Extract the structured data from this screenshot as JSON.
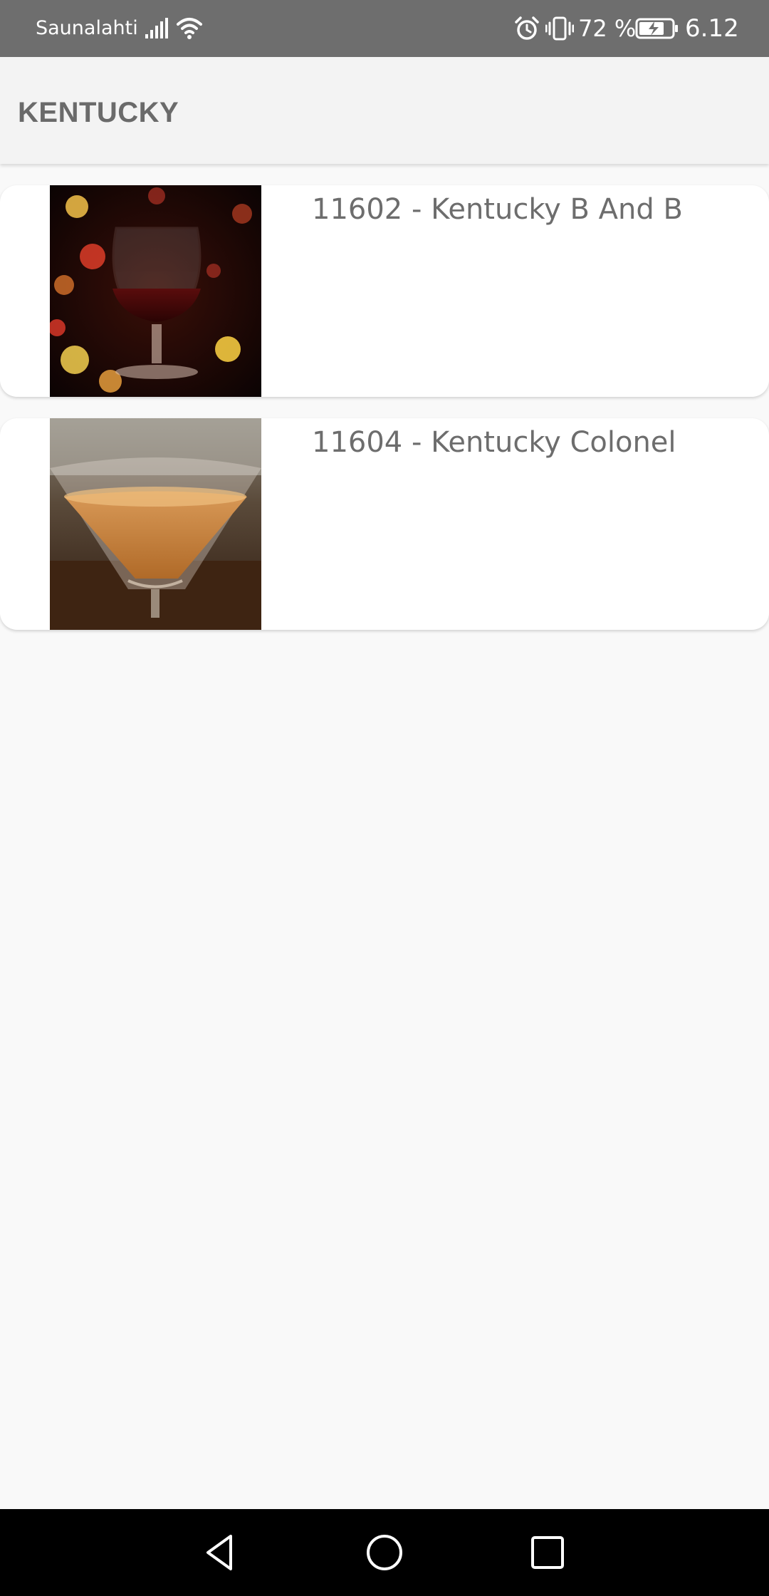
{
  "status_bar": {
    "carrier": "Saunalahti",
    "battery_percent": "72 %",
    "time": "6.12",
    "icons": [
      "signal-icon",
      "wifi-icon",
      "alarm-icon",
      "vibrate-icon",
      "battery-charging-icon"
    ]
  },
  "app_bar": {
    "title": "KENTUCKY"
  },
  "drinks": [
    {
      "label": "11602 - Kentucky B And B",
      "image": "brandy-snifter-image"
    },
    {
      "label": "11604 - Kentucky Colonel",
      "image": "martini-glass-image"
    }
  ],
  "nav_bar": {
    "icons": [
      "back-icon",
      "home-icon",
      "recents-icon"
    ]
  }
}
